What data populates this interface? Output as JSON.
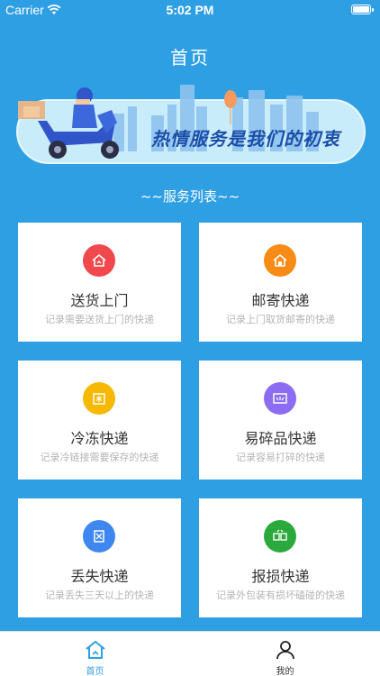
{
  "status_bar": {
    "carrier": "Carrier",
    "time": "5:02 PM"
  },
  "nav": {
    "title": "首页"
  },
  "banner": {
    "slogan": "热情服务是我们的初衷"
  },
  "section": {
    "title": "~~服务列表~~"
  },
  "services": [
    {
      "title": "送货上门",
      "desc": "记录需要送货上门的快递",
      "icon": "house-icon",
      "color": "#f0484d"
    },
    {
      "title": "邮寄快递",
      "desc": "记录上门取货邮寄的快递",
      "icon": "mail-house-icon",
      "color": "#f78b16"
    },
    {
      "title": "冷冻快递",
      "desc": "记录冷链接需要保存的快递",
      "icon": "snowflake-box-icon",
      "color": "#f6b800"
    },
    {
      "title": "易碎品快递",
      "desc": "记录容易打碎的快递",
      "icon": "fragile-box-icon",
      "color": "#8c6cf0"
    },
    {
      "title": "丢失快递",
      "desc": "记录丢失三天以上的快递",
      "icon": "missing-package-icon",
      "color": "#3e87f0"
    },
    {
      "title": "报损快递",
      "desc": "记录外包装有损坏磕碰的快递",
      "icon": "damaged-package-icon",
      "color": "#2ba93c"
    }
  ],
  "tabs": [
    {
      "label": "首页",
      "icon": "home-icon",
      "active": true
    },
    {
      "label": "我的",
      "icon": "user-icon",
      "active": false
    }
  ],
  "colors": {
    "background": "#2f9fe3",
    "accent": "#2f9fe3",
    "slogan": "#1d4ea8"
  }
}
